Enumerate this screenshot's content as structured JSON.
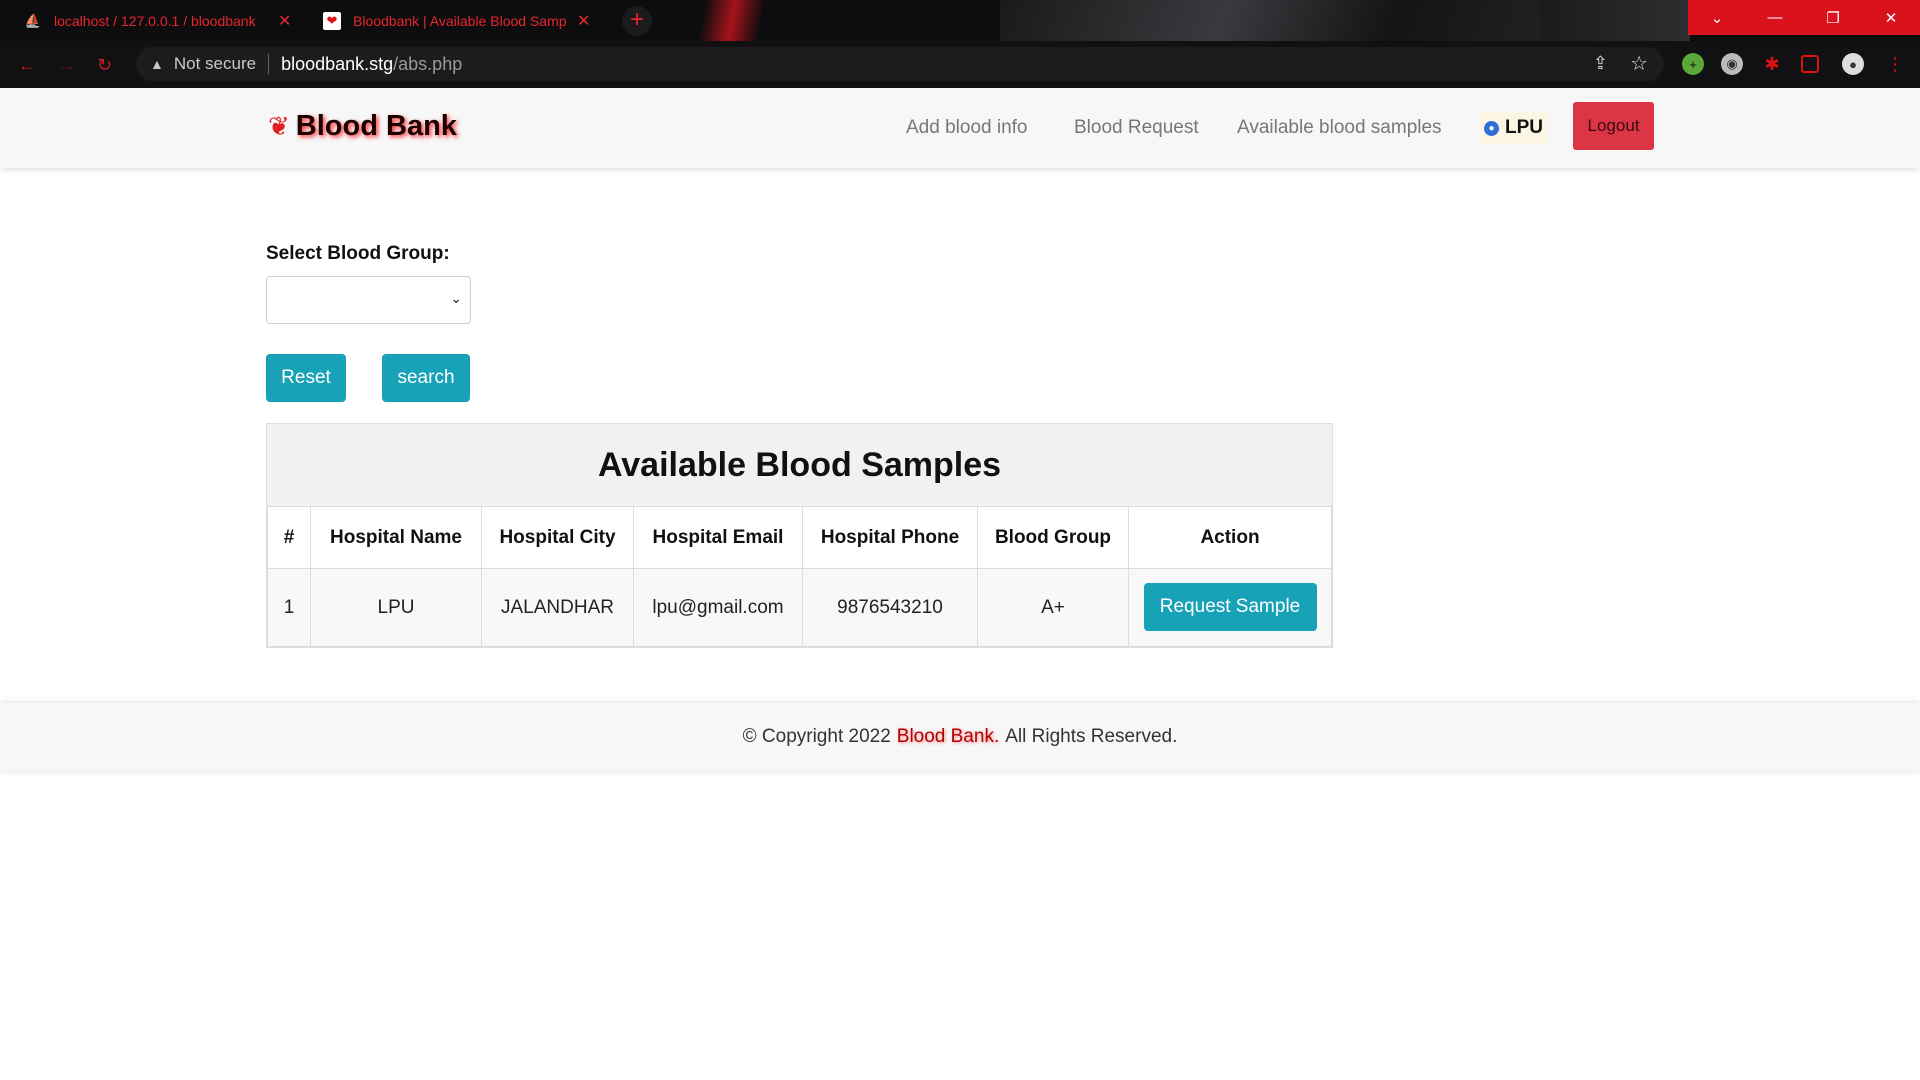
{
  "browser": {
    "tabs": [
      {
        "title": "localhost / 127.0.0.1 / bloodbank",
        "icon": "phpmyadmin-icon"
      },
      {
        "title": "Bloodbank | Available Blood Samples",
        "icon": "bloodbank-favicon"
      }
    ],
    "address": {
      "security_label": "Not secure",
      "host": "bloodbank.stg",
      "path": "/abs.php"
    }
  },
  "header": {
    "brand": "Blood Bank",
    "nav": {
      "add": "Add blood info",
      "request": "Blood Request",
      "available": "Available blood samples"
    },
    "user": "LPU",
    "logout": "Logout"
  },
  "filter": {
    "label": "Select Blood Group:",
    "selected": "",
    "reset": "Reset",
    "search": "search"
  },
  "table": {
    "title": "Available Blood Samples",
    "headers": [
      "#",
      "Hospital Name",
      "Hospital City",
      "Hospital Email",
      "Hospital Phone",
      "Blood Group",
      "Action"
    ],
    "rows": [
      {
        "n": "1",
        "name": "LPU",
        "city": "JALANDHAR",
        "email": "lpu@gmail.com",
        "phone": "9876543210",
        "group": "A+",
        "action": "Request Sample"
      }
    ]
  },
  "footer": {
    "prefix": "© Copyright 2022",
    "brand": "Blood Bank.",
    "suffix": "All Rights Reserved."
  },
  "colors": {
    "accent_teal": "#17a2b8",
    "danger": "#dc3545",
    "brand_red": "#e32020"
  }
}
